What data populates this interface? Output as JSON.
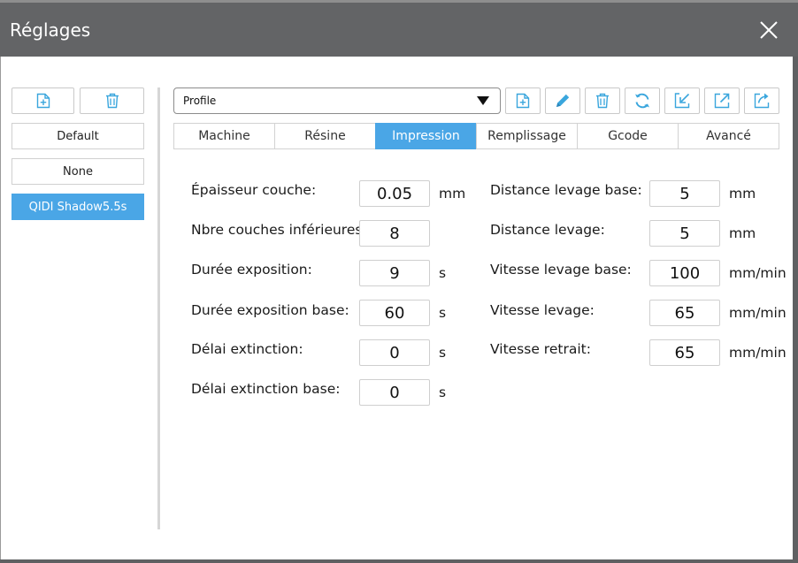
{
  "window": {
    "title": "Réglages"
  },
  "left_panel": {
    "profiles": [
      {
        "label": "Default",
        "selected": false
      },
      {
        "label": "None",
        "selected": false
      },
      {
        "label": "QIDI Shadow5.5s",
        "selected": true
      }
    ]
  },
  "toolbar": {
    "profile_select": "Profile",
    "icons": [
      "add-file-icon",
      "pencil-icon",
      "trash-icon",
      "refresh-icon",
      "import-icon",
      "export-icon",
      "share-icon"
    ]
  },
  "tabs": [
    {
      "label": "Machine",
      "active": false
    },
    {
      "label": "Résine",
      "active": false
    },
    {
      "label": "Impression",
      "active": true
    },
    {
      "label": "Remplissage",
      "active": false
    },
    {
      "label": "Gcode",
      "active": false
    },
    {
      "label": "Avancé",
      "active": false
    }
  ],
  "settings": {
    "left": [
      {
        "label": "Épaisseur couche:",
        "value": "0.05",
        "unit": "mm"
      },
      {
        "label": "Nbre couches inférieures:",
        "value": "8",
        "unit": ""
      },
      {
        "label": "Durée exposition:",
        "value": "9",
        "unit": "s"
      },
      {
        "label": "Durée exposition base:",
        "value": "60",
        "unit": "s"
      },
      {
        "label": "Délai extinction:",
        "value": "0",
        "unit": "s"
      },
      {
        "label": "Délai extinction base:",
        "value": "0",
        "unit": "s"
      }
    ],
    "right": [
      {
        "label": "Distance levage base:",
        "value": "5",
        "unit": "mm"
      },
      {
        "label": "Distance levage:",
        "value": "5",
        "unit": "mm"
      },
      {
        "label": "Vitesse levage base:",
        "value": "100",
        "unit": "mm/min"
      },
      {
        "label": "Vitesse levage:",
        "value": "65",
        "unit": "mm/min"
      },
      {
        "label": "Vitesse retrait:",
        "value": "65",
        "unit": "mm/min"
      }
    ]
  },
  "colors": {
    "accent": "#4aa6e6",
    "icon": "#3aa6dd",
    "titlebar": "#636466"
  }
}
